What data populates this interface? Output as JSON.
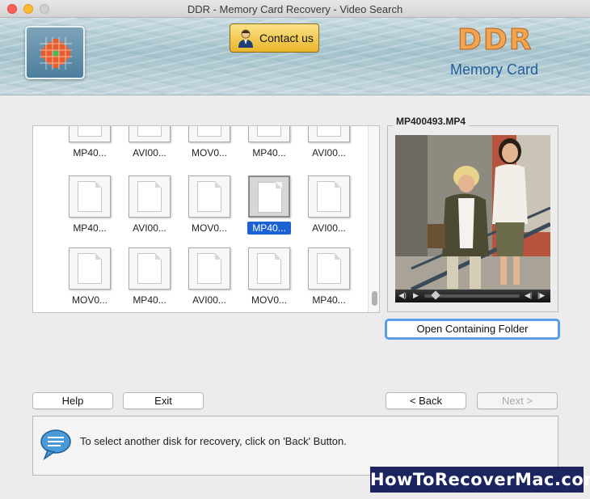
{
  "window": {
    "title": "DDR - Memory Card Recovery - Video Search"
  },
  "header": {
    "contact_label": "Contact us",
    "brand_title": "DDR",
    "brand_subtitle": "Memory Card"
  },
  "file_grid": {
    "rows": [
      [
        "MP40...",
        "AVI00...",
        "MOV0...",
        "MP40...",
        "AVI00..."
      ],
      [
        "MP40...",
        "AVI00...",
        "MOV0...",
        "MP40...",
        "AVI00..."
      ],
      [
        "MOV0...",
        "MP40...",
        "AVI00...",
        "MOV0...",
        "MP40..."
      ]
    ],
    "selected": {
      "row": 1,
      "col": 3
    }
  },
  "preview": {
    "title": "MP400493.MP4",
    "open_folder_label": "Open Containing Folder"
  },
  "buttons": {
    "help": "Help",
    "exit": "Exit",
    "back": "< Back",
    "next": "Next >"
  },
  "info": {
    "message": "To select another disk for recovery, click on 'Back' Button."
  },
  "watermark": "HowToRecoverMac.com"
}
